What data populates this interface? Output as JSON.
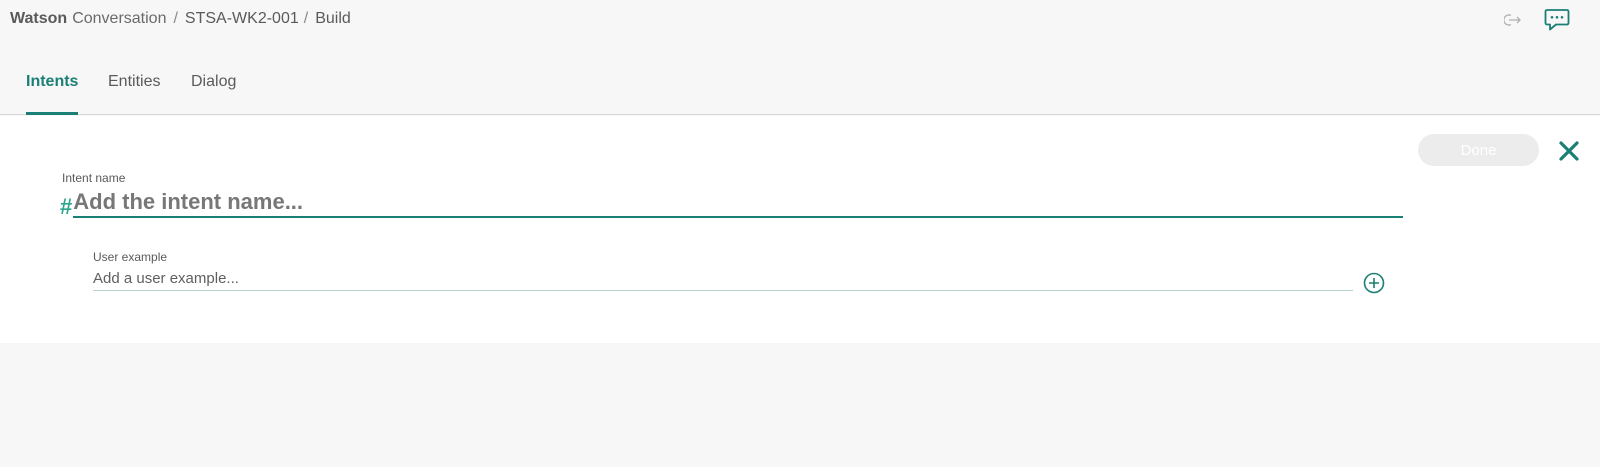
{
  "breadcrumb": {
    "brand_strong": "Watson",
    "brand_light": "Conversation",
    "separator": "/",
    "workspace": "STSA-WK2-001",
    "page": "Build"
  },
  "icons": {
    "logout": "logout-icon",
    "chat": "chat-bubble-icon",
    "close": "close-icon",
    "add": "add-circle-icon"
  },
  "tabs": [
    {
      "label": "Intents",
      "active": true
    },
    {
      "label": "Entities",
      "active": false
    },
    {
      "label": "Dialog",
      "active": false
    }
  ],
  "editor": {
    "done_label": "Done",
    "intent_name_label": "Intent name",
    "hash_prefix": "#",
    "intent_placeholder": "Add the intent name...",
    "user_example_label": "User example",
    "user_example_placeholder": "Add a user example..."
  },
  "colors": {
    "accent": "#1a7f75",
    "hash": "#2da58f",
    "background": "#f7f7f7",
    "panel": "#ffffff"
  }
}
